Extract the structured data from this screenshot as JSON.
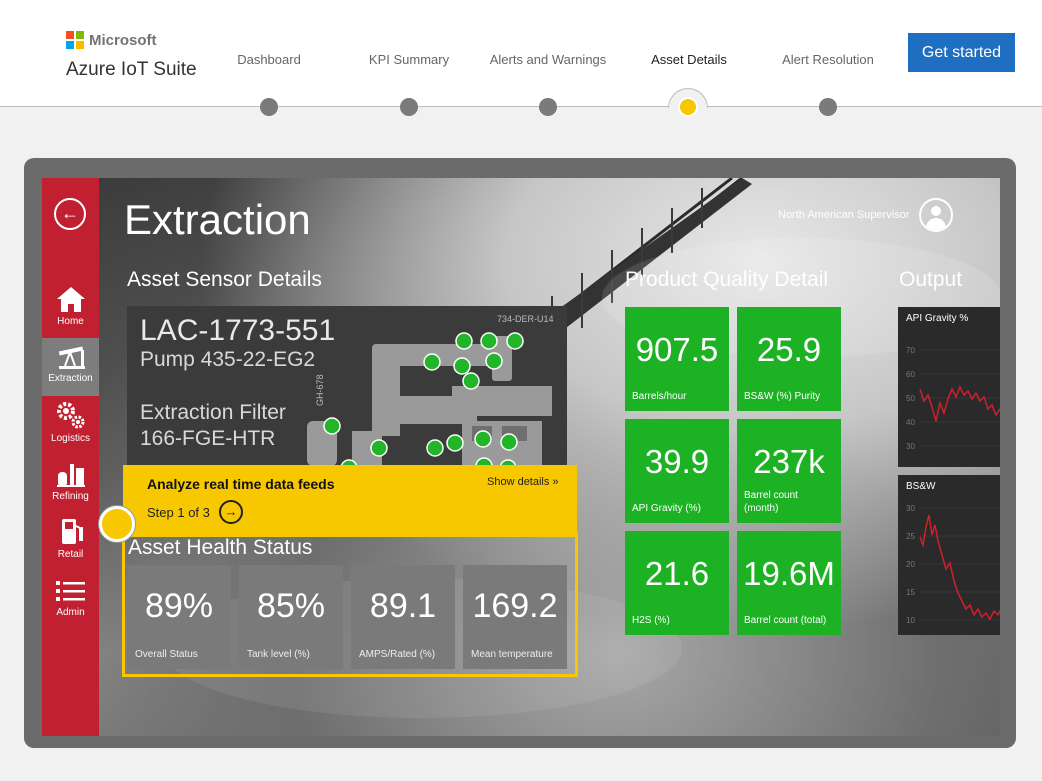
{
  "header": {
    "brand_company": "Microsoft",
    "brand_product": "Azure IoT Suite",
    "tabs": [
      {
        "label": "Dashboard"
      },
      {
        "label": "KPI Summary"
      },
      {
        "label": "Alerts and Warnings"
      },
      {
        "label": "Asset Details"
      },
      {
        "label": "Alert Resolution"
      }
    ],
    "active_tab": "Asset Details",
    "cta_label": "Get started",
    "colors": {
      "cta": "#1e6fc2",
      "active_dot": "#f7c800"
    }
  },
  "app": {
    "title": "Extraction",
    "user": "North American Supervisor",
    "back_icon": "arrow-left-icon",
    "sidebar": [
      {
        "label": "Home",
        "icon": "home-icon"
      },
      {
        "label": "Extraction",
        "icon": "pumpjack-icon",
        "active": true
      },
      {
        "label": "Logistics",
        "icon": "gears-icon"
      },
      {
        "label": "Refining",
        "icon": "refinery-icon"
      },
      {
        "label": "Retail",
        "icon": "fuel-pump-icon"
      },
      {
        "label": "Admin",
        "icon": "list-icon"
      }
    ],
    "sensor": {
      "section_title": "Asset Sensor Details",
      "asset_id": "LAC-1773-551",
      "pump": "Pump 435-22-EG2",
      "filter_line1": "Extraction Filter",
      "filter_line2": "166-FGE-HTR",
      "tag_top": "734-DER-U14",
      "tag_side": "GH-678"
    },
    "health": {
      "section_title": "Asset Health Status",
      "tiles": [
        {
          "value": "89%",
          "label": "Overall Status"
        },
        {
          "value": "85%",
          "label": "Tank level (%)"
        },
        {
          "value": "89.1",
          "label": "AMPS/Rated (%)"
        },
        {
          "value": "169.2",
          "label": "Mean temperature"
        }
      ]
    },
    "quality": {
      "section_title": "Product Quality Detail",
      "tiles": [
        {
          "value": "907.5",
          "label": "Barrels/hour"
        },
        {
          "value": "25.9",
          "label": "BS&W (%) Purity"
        },
        {
          "value": "39.9",
          "label": "API Gravity (%)"
        },
        {
          "value": "237k",
          "label": "Barrel count (month)"
        },
        {
          "value": "21.6",
          "label": "H2S (%)"
        },
        {
          "value": "19.6M",
          "label": "Barrel count (total)"
        }
      ]
    },
    "output": {
      "section_title": "Output",
      "charts": [
        {
          "title": "API Gravity %",
          "yticks": [
            "70",
            "60",
            "50",
            "40",
            "30"
          ]
        },
        {
          "title": "BS&W",
          "yticks": [
            "30",
            "25",
            "20",
            "15",
            "10"
          ]
        }
      ]
    }
  },
  "callout": {
    "title": "Analyze real time data feeds",
    "link": "Show details »",
    "step": "Step 1 of 3",
    "next_icon": "arrow-right-circle-icon"
  }
}
